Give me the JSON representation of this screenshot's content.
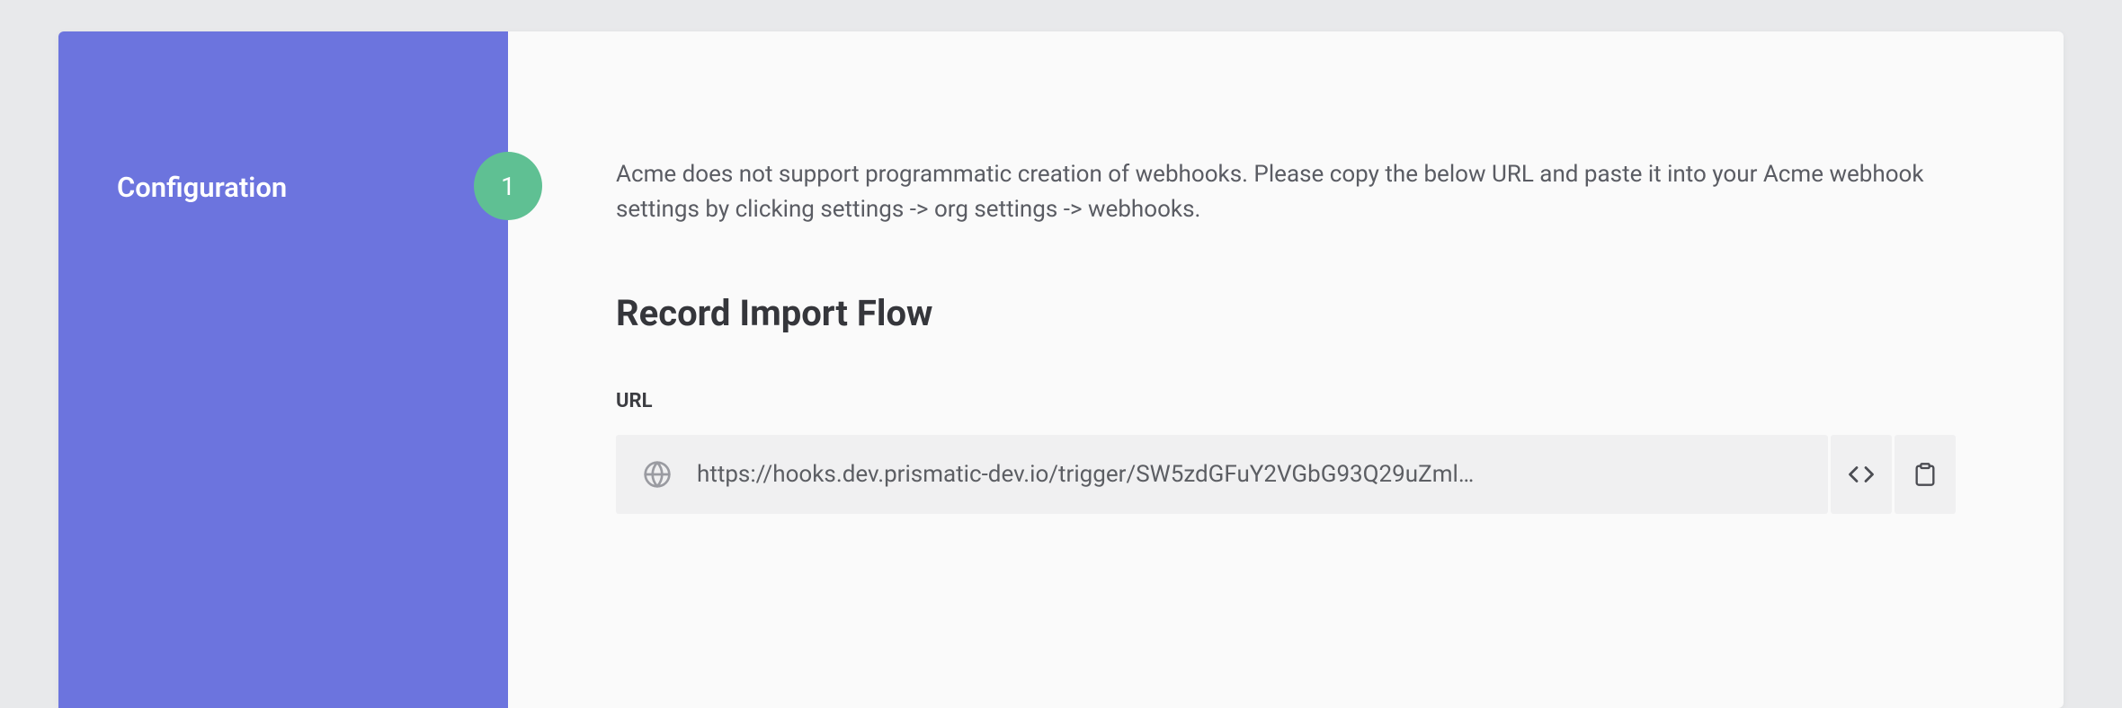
{
  "sidebar": {
    "title": "Configuration",
    "step_number": "1"
  },
  "main": {
    "instructions": "Acme does not support programmatic creation of webhooks. Please copy the below URL and paste it into your Acme webhook settings by clicking settings -> org settings -> webhooks.",
    "section_title": "Record Import Flow",
    "url_label": "URL",
    "url_value": "https://hooks.dev.prismatic-dev.io/trigger/SW5zdGFuY2VGbG93Q29uZml…"
  }
}
